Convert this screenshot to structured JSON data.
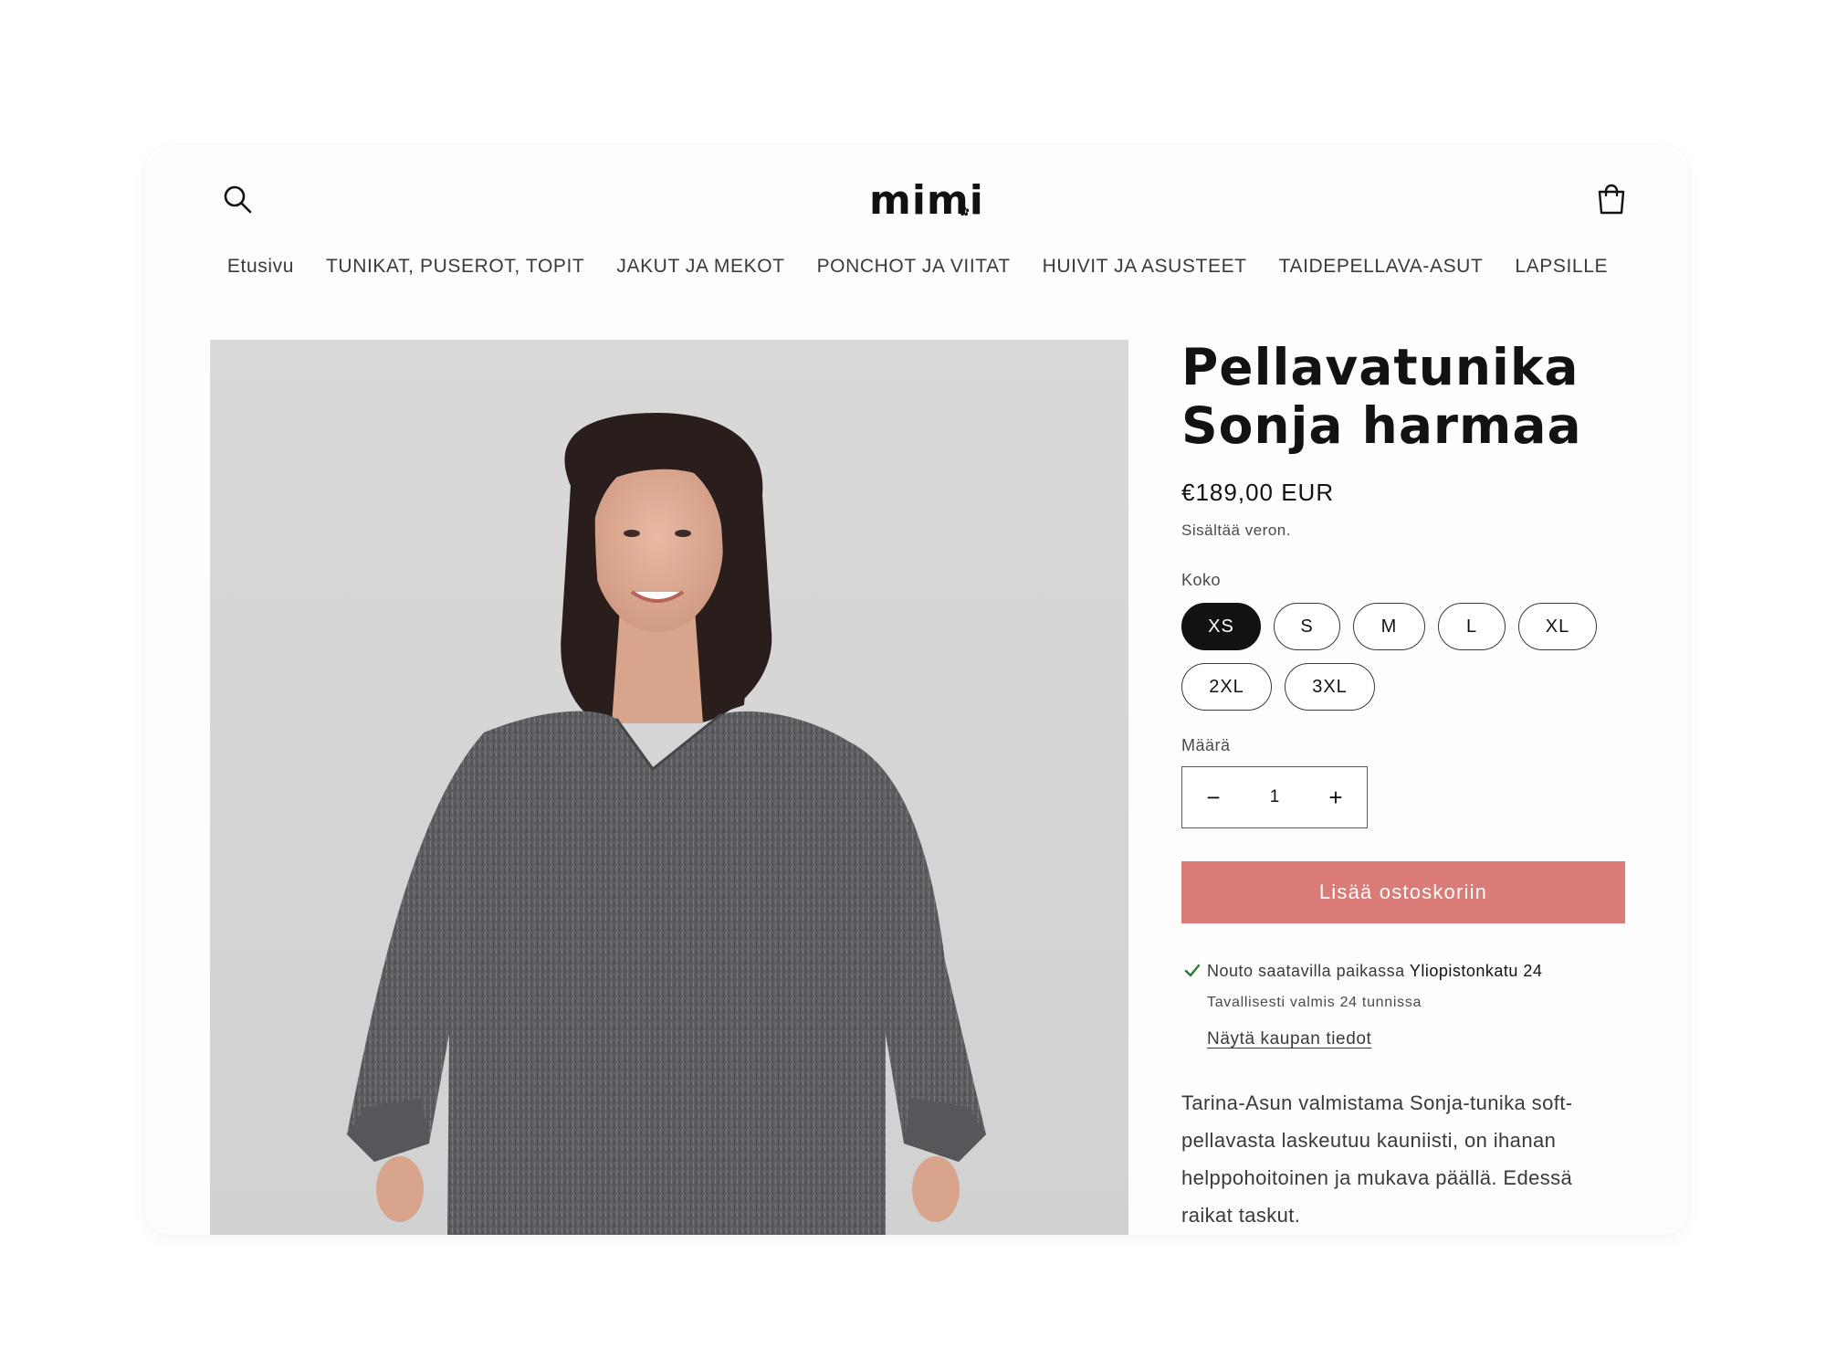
{
  "header": {
    "logo": "mimi",
    "search_icon": "search-icon",
    "cart_icon": "cart-icon"
  },
  "nav": {
    "items": [
      "Etusivu",
      "TUNIKAT, PUSEROT, TOPIT",
      "JAKUT JA MEKOT",
      "PONCHOT JA VIITAT",
      "HUIVIT JA ASUSTEET",
      "TAIDEPELLAVA-ASUT",
      "LAPSILLE"
    ]
  },
  "product": {
    "title_line1": "Pellavatunika",
    "title_line2": "Sonja harmaa",
    "price": "€189,00 EUR",
    "tax_note": "Sisältää veron.",
    "size_label": "Koko",
    "sizes": [
      "XS",
      "S",
      "M",
      "L",
      "XL",
      "2XL",
      "3XL"
    ],
    "selected_size": "XS",
    "quantity_label": "Määrä",
    "quantity": "1",
    "quantity_minus": "−",
    "quantity_plus": "+",
    "add_to_cart": "Lisää ostoskoriin",
    "pickup_text": "Nouto saatavilla paikassa",
    "pickup_location": "Yliopistonkatu 24",
    "pickup_time": "Tavallisesti valmis 24 tunnissa",
    "store_link": "Näytä kaupan tiedot",
    "description": "Tarina-Asun valmistama Sonja-tunika soft-pellavasta laskeutuu kauniisti, on ihanan helppohoitoinen ja mukava päällä. Edessä raikat taskut."
  },
  "colors": {
    "accent": "#db7b77",
    "selected_pill": "#121212",
    "text": "#121212",
    "muted": "#4a4a4a"
  }
}
